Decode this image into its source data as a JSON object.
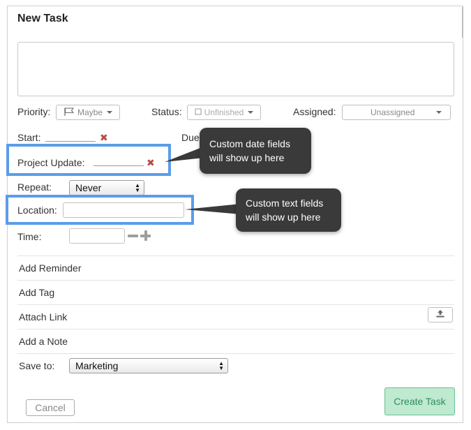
{
  "dialog": {
    "title": "New Task",
    "task_text": ""
  },
  "fields": {
    "priority_label": "Priority:",
    "priority_value": "Maybe",
    "priority_icon": "flag-icon",
    "status_label": "Status:",
    "status_value": "Unfinished",
    "status_icon": "checkbox-icon",
    "assigned_label": "Assigned:",
    "assigned_value": "Unassigned",
    "start_label": "Start:",
    "due_label": "Due",
    "project_update_label": "Project Update:",
    "repeat_label": "Repeat:",
    "repeat_value": "Never",
    "location_label": "Location:",
    "location_value": "",
    "time_label": "Time:",
    "time_value": ""
  },
  "rows": {
    "add_reminder": "Add Reminder",
    "add_tag": "Add Tag",
    "attach_link": "Attach Link",
    "add_note": "Add a Note",
    "save_to_label": "Save to:",
    "save_to_value": "Marketing"
  },
  "callouts": {
    "date_fields_line1": "Custom date fields",
    "date_fields_line2": "will show up here",
    "text_fields_line1": "Custom text fields",
    "text_fields_line2": "will show up here"
  },
  "buttons": {
    "cancel": "Cancel",
    "create": "Create Task"
  },
  "colors": {
    "highlight": "#5b9de9",
    "create_bg": "#bfe9d0",
    "create_text": "#2f8f5c",
    "remove_icon": "#b94a48",
    "tooltip_bg": "#3a3a3a"
  }
}
